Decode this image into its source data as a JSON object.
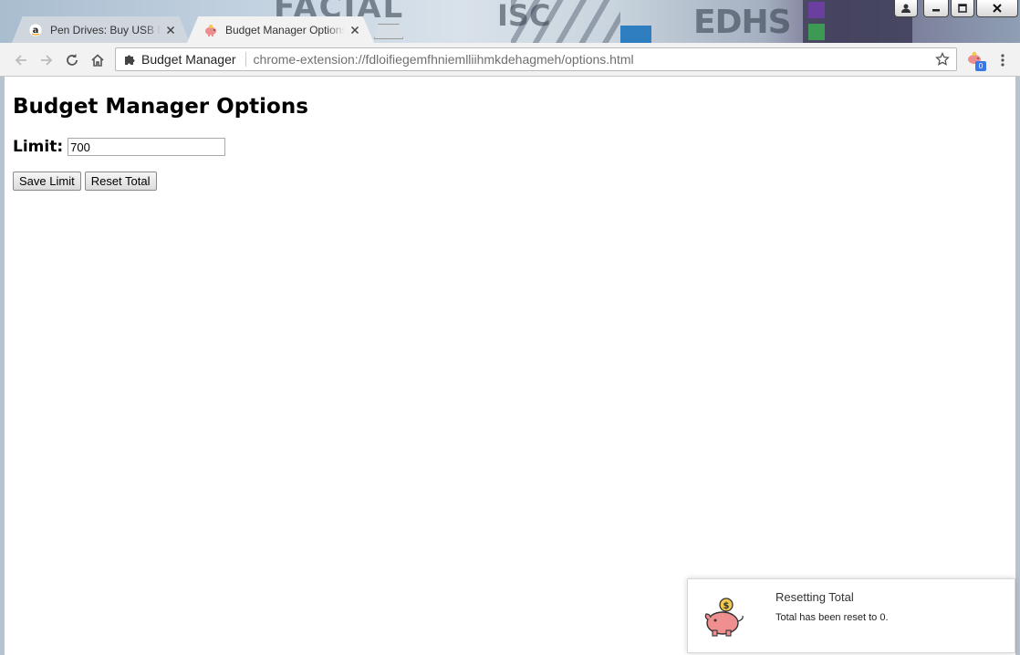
{
  "browser": {
    "tabs": [
      {
        "title": "Pen Drives: Buy USB Drives",
        "favicon": "amazon-icon",
        "active": false
      },
      {
        "title": "Budget Manager Options",
        "favicon": "piggy-bank-icon",
        "active": true
      }
    ],
    "omnibox": {
      "origin_label": "Budget Manager",
      "url": "chrome-extension://fdloifiegemfhniemlliihmkdehagmeh/options.html"
    },
    "extension_badge": "0"
  },
  "page": {
    "heading": "Budget Manager Options",
    "limit_label": "Limit:",
    "limit_value": "700",
    "save_button": "Save Limit",
    "reset_button": "Reset Total"
  },
  "notification": {
    "title": "Resetting Total",
    "message": "Total has been reset to 0."
  },
  "colors": {
    "notification_accent": "#f0a0a0",
    "coin": "#f2c94c",
    "badge": "#3b78e7"
  }
}
